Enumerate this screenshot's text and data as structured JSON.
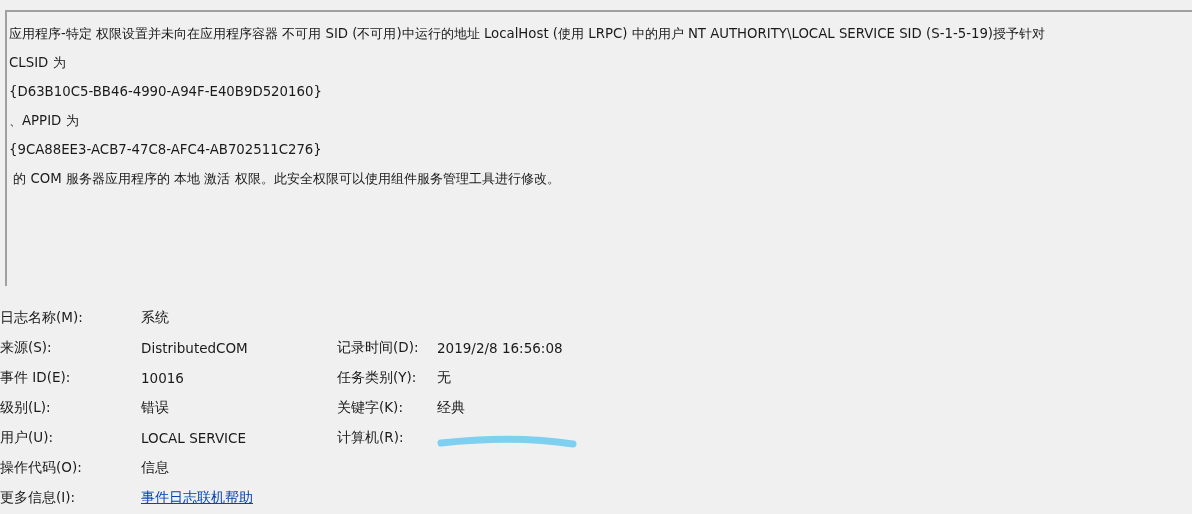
{
  "description": {
    "lines": [
      "应用程序-特定 权限设置并未向在应用程序容器 不可用 SID (不可用)中运行的地址 LocalHost (使用 LRPC) 中的用户 NT AUTHORITY\\LOCAL SERVICE SID (S-1-5-19)授予针对",
      "CLSID 为",
      "{D63B10C5-BB46-4990-A94F-E40B9D520160}",
      "、APPID 为",
      "{9CA88EE3-ACB7-47C8-AFC4-AB702511C276}",
      " 的 COM 服务器应用程序的 本地 激活 权限。此安全权限可以使用组件服务管理工具进行修改。"
    ]
  },
  "fields": [
    {
      "left": {
        "label": "日志名称(M):",
        "value": "系统"
      }
    },
    {
      "left": {
        "label": "来源(S):",
        "value": "DistributedCOM"
      },
      "right": {
        "label": "记录时间(D):",
        "value": "2019/2/8 16:56:08"
      }
    },
    {
      "left": {
        "label": "事件 ID(E):",
        "value": "10016"
      },
      "right": {
        "label": "任务类别(Y):",
        "value": "无"
      }
    },
    {
      "left": {
        "label": "级别(L):",
        "value": "错误"
      },
      "right": {
        "label": "关键字(K):",
        "value": "经典"
      }
    },
    {
      "left": {
        "label": "用户(U):",
        "value": "LOCAL SERVICE"
      },
      "right": {
        "label": "计算机(R):",
        "redacted": true
      }
    },
    {
      "left": {
        "label": "操作代码(O):",
        "value": "信息"
      }
    },
    {
      "left": {
        "label": "更多信息(I):",
        "value": "事件日志联机帮助",
        "kind": "link"
      }
    }
  ]
}
